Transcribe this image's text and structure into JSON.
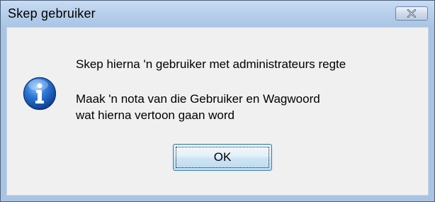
{
  "window": {
    "title": "Skep gebruiker",
    "close_icon": "close-x-icon"
  },
  "message": {
    "icon": "information-icon",
    "line1": "Skep hierna 'n gebruiker met administrateurs regte",
    "line2": "Maak 'n nota van die Gebruiker en Wagwoord",
    "line3": "wat hierna vertoon gaan word"
  },
  "buttons": {
    "ok_label": "OK"
  },
  "colors": {
    "frame": "#a9c3e2",
    "client": "#f0f0f0",
    "icon_blue": "#1f5fb8",
    "ok_border": "#3c7fb1"
  }
}
